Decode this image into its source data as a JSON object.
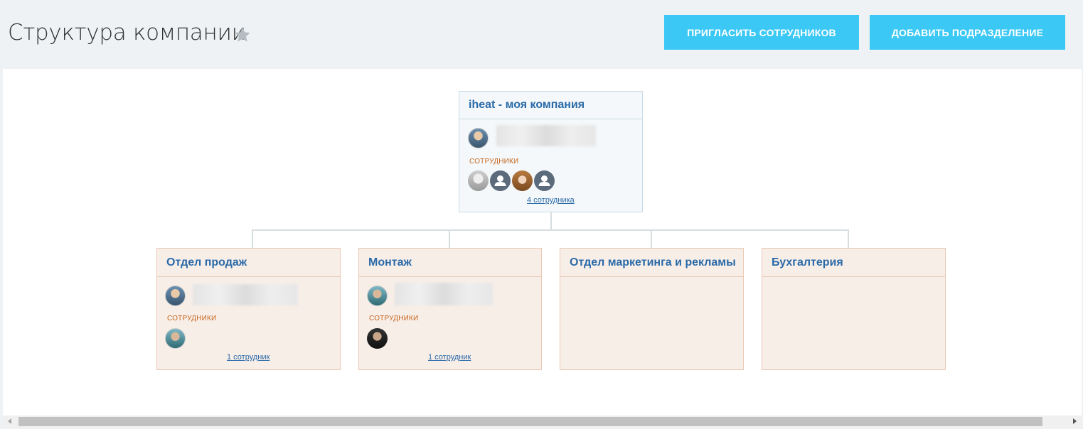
{
  "header": {
    "title": "Структура компании",
    "star_icon": "star-icon",
    "invite_button": "ПРИГЛАСИТЬ СОТРУДНИКОВ",
    "add_department_button": "ДОБАВИТЬ ПОДРАЗДЕЛЕНИЕ",
    "button_color": "#3bc8f5"
  },
  "root": {
    "title": "iheat - моя компания",
    "staff_label": "СОТРУДНИКИ",
    "staff_count": "4 сотрудника"
  },
  "departments": [
    {
      "title": "Отдел продаж",
      "staff_label": "СОТРУДНИКИ",
      "staff_count": "1 сотрудник"
    },
    {
      "title": "Монтаж",
      "staff_label": "СОТРУДНИКИ",
      "staff_count": "1 сотрудник"
    },
    {
      "title": "Отдел маркетинга и рекламы"
    },
    {
      "title": "Бухгалтерия"
    }
  ],
  "colors": {
    "title_blue": "#2a6aa8",
    "staff_label_orange": "#c5651d",
    "dept_card_bg": "#f8eee8",
    "root_card_bg": "#f4f8fa"
  }
}
